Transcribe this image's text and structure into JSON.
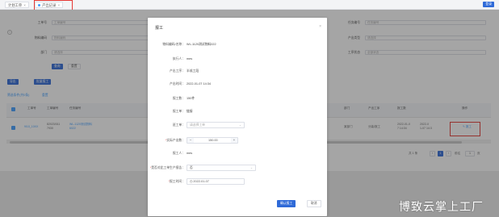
{
  "tabs": [
    {
      "label": "计划工单",
      "close": "×"
    },
    {
      "label": "产出记录",
      "close": "×"
    }
  ],
  "top_button": "登录",
  "filters": {
    "row1": {
      "label_left": "工单号",
      "placeholder_left": "工单编号",
      "label_right": "任务编号",
      "placeholder_right": "任务编号"
    },
    "row2": {
      "label_left": "物料编码",
      "placeholder_left": "物料编码",
      "label_right": "产出类型",
      "placeholder_right": "请选择"
    },
    "row3": {
      "label_left": "部门",
      "placeholder_left": "请选择",
      "label_right": "工序状态",
      "placeholder_right": "全部状态"
    }
  },
  "search_button": "查询",
  "reset_button": "重置",
  "collapse_icon": "‹",
  "toolbar": {
    "import": "导出",
    "batch": "批量报工",
    "filter_link": "筛选条件(共0条)",
    "reset_link": "重置"
  },
  "table": {
    "headers": [
      "工单号",
      "工单编号",
      "任务编号",
      "部门",
      "产出工序",
      "报工数",
      "操作"
    ],
    "row": {
      "col1": "9/10_10XX",
      "col2": "82023/011\n7930",
      "col3": "WL-1120测试物料\n6022",
      "col4": "某部门",
      "col5": "分装/报工",
      "col6": "2022-01-0\n7 14:34",
      "col7": "2022-0\n1-07 14:3",
      "action": "报工",
      "action_icon": "✎"
    }
  },
  "pager": {
    "total": "共 1 条",
    "page": "1",
    "goto": "前往",
    "goto_suffix": "页",
    "prev": "‹",
    "next": "›",
    "goto_value": "1"
  },
  "dialog": {
    "title": "报工",
    "close": "×",
    "fields": [
      {
        "label": "物料编码/名称：",
        "value": "WL-1120测试物料022"
      },
      {
        "label": "执行人：",
        "value": "mes"
      },
      {
        "label": "产出工序：",
        "value": "半成工段"
      },
      {
        "label": "产出时间：",
        "value": "2022-01-07 14:34"
      },
      {
        "label": "报工数：",
        "value": "150件"
      },
      {
        "label": "报工单：",
        "value": "链接"
      }
    ],
    "work_label": "班工单：",
    "work_placeholder": "请选择工单",
    "qty_label": "实际产出数：",
    "qty_value": "150.00",
    "qty_minus": "−",
    "qty_plus": "+",
    "reporter_label": "报工人：",
    "reporter_value": "mes",
    "last_label": "是否对此工单生产报告：",
    "last_value": "否",
    "date_label": "报工时间：",
    "date_value": "2022-01-07",
    "date_icon": "◷",
    "confirm": "确认报工",
    "cancel": "取消"
  },
  "watermark": "博致云掌上工厂"
}
